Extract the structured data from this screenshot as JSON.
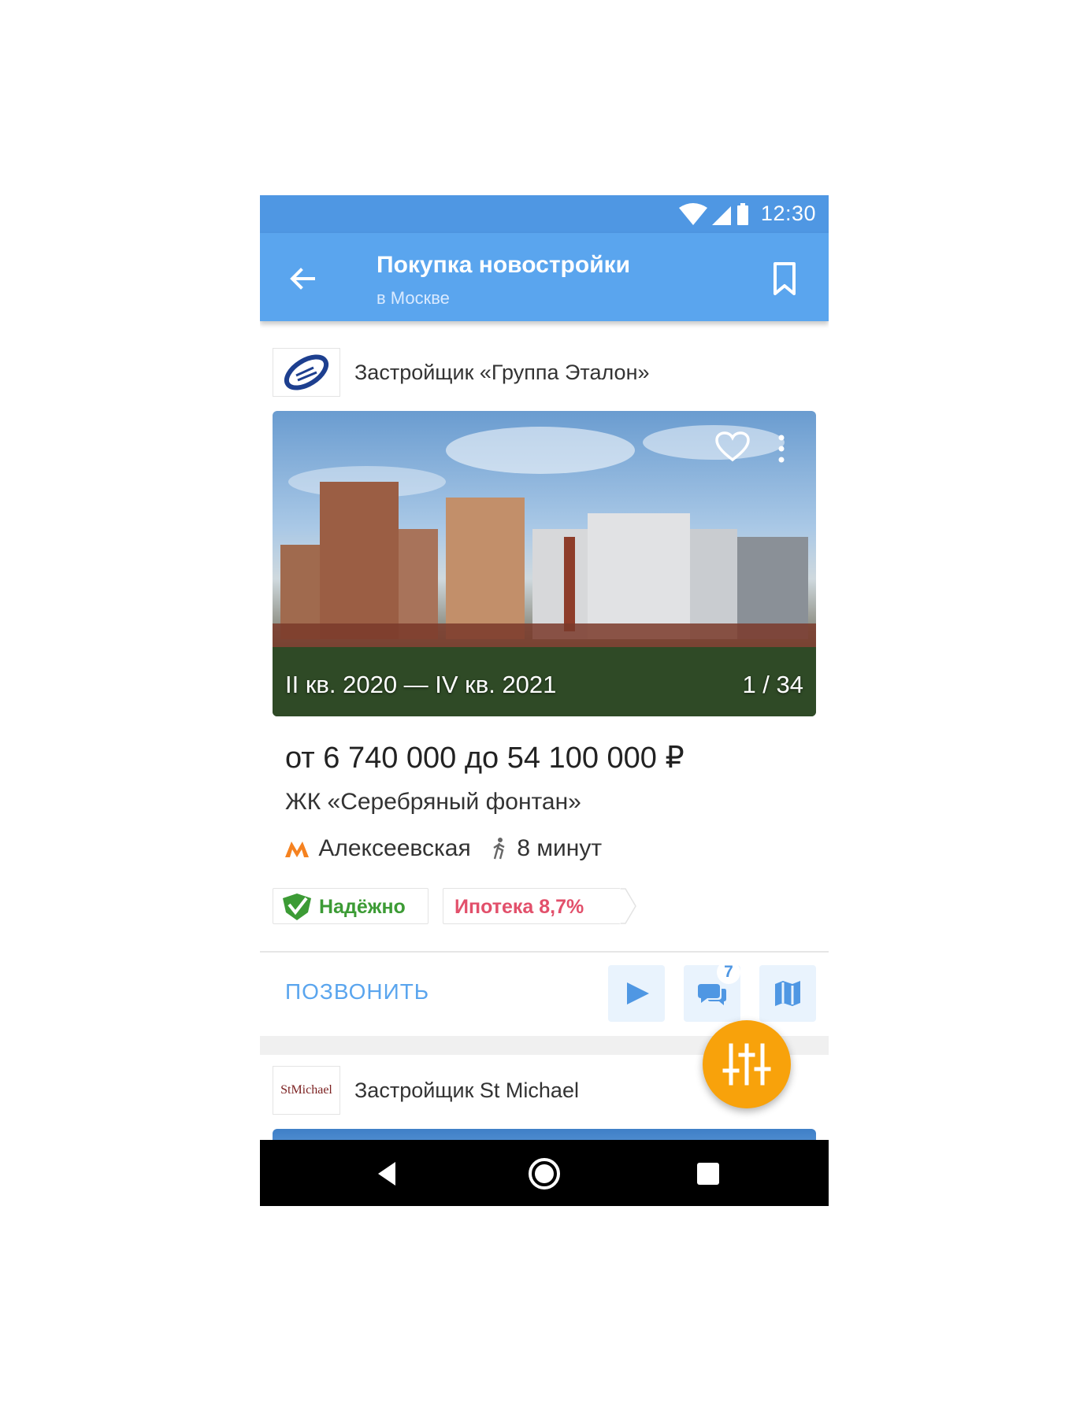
{
  "status_bar": {
    "time": "12:30",
    "icons": [
      "wifi-icon",
      "cellular-signal-icon",
      "battery-icon"
    ]
  },
  "app_bar": {
    "title": "Покупка новостройки",
    "subtitle": "в Москве",
    "back_icon": "arrow-back-icon",
    "bookmark_icon": "bookmark-icon",
    "color": "#5aa5ee"
  },
  "listings": [
    {
      "developer": "Застройщик «Группа Эталон»",
      "photo": {
        "dates": "II кв. 2020 — IV кв. 2021",
        "counter": "1 / 34"
      },
      "price": "от 6 740 000 до 54 100 000 ₽",
      "complex": "ЖК «Серебряный фонтан»",
      "metro": {
        "station": "Алексеевская",
        "line_color": "#f58220",
        "walk_time": "8 минут"
      },
      "badges": {
        "reliable": "Надёжно",
        "mortgage": "Ипотека 8,7%"
      },
      "actions": {
        "call": "ПОЗВОНИТЬ",
        "comments_count": "7"
      }
    },
    {
      "developer": "Застройщик St Michael",
      "logo_text": "StMichael"
    }
  ],
  "fab": {
    "icon": "filter-sliders-icon",
    "color": "#f8a20b"
  },
  "nav_bar": {
    "icons": [
      "nav-back-icon",
      "nav-home-icon",
      "nav-recents-icon"
    ]
  }
}
